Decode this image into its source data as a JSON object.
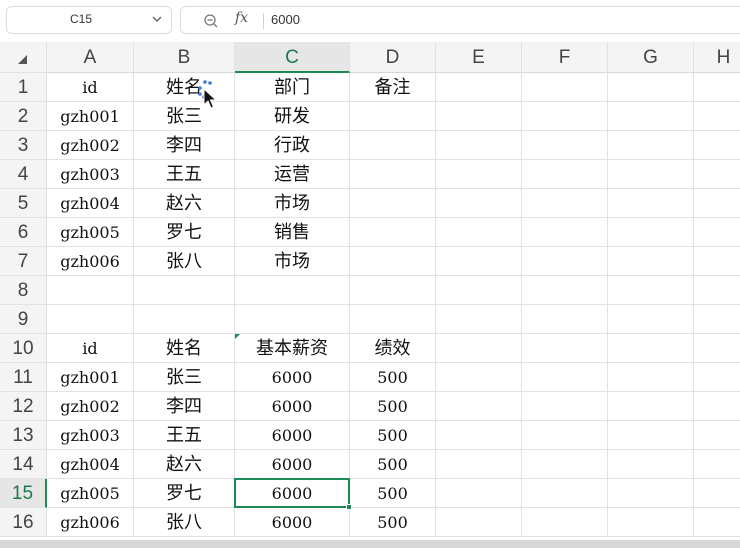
{
  "namebox": {
    "cell_ref": "C15"
  },
  "formula_bar": {
    "fx_label": "fx",
    "value": "6000"
  },
  "columns": [
    "A",
    "B",
    "C",
    "D",
    "E",
    "F",
    "G",
    "H"
  ],
  "active_column": "C",
  "active_row": "15",
  "rows": [
    {
      "num": "1",
      "cells": [
        "id",
        "姓名",
        "部门",
        "备注"
      ]
    },
    {
      "num": "2",
      "cells": [
        "gzh001",
        "张三",
        "研发",
        ""
      ]
    },
    {
      "num": "3",
      "cells": [
        "gzh002",
        "李四",
        "行政",
        ""
      ]
    },
    {
      "num": "4",
      "cells": [
        "gzh003",
        "王五",
        "运营",
        ""
      ]
    },
    {
      "num": "5",
      "cells": [
        "gzh004",
        "赵六",
        "市场",
        ""
      ]
    },
    {
      "num": "6",
      "cells": [
        "gzh005",
        "罗七",
        "销售",
        ""
      ]
    },
    {
      "num": "7",
      "cells": [
        "gzh006",
        "张八",
        "市场",
        ""
      ]
    },
    {
      "num": "8",
      "cells": [
        "",
        "",
        "",
        ""
      ]
    },
    {
      "num": "9",
      "cells": [
        "",
        "",
        "",
        ""
      ]
    },
    {
      "num": "10",
      "cells": [
        "id",
        "姓名",
        "基本薪资",
        "绩效"
      ]
    },
    {
      "num": "11",
      "cells": [
        "gzh001",
        "张三",
        "6000",
        "500"
      ]
    },
    {
      "num": "12",
      "cells": [
        "gzh002",
        "李四",
        "6000",
        "500"
      ]
    },
    {
      "num": "13",
      "cells": [
        "gzh003",
        "王五",
        "6000",
        "500"
      ]
    },
    {
      "num": "14",
      "cells": [
        "gzh004",
        "赵六",
        "6000",
        "500"
      ]
    },
    {
      "num": "15",
      "cells": [
        "gzh005",
        "罗七",
        "6000",
        "500"
      ]
    },
    {
      "num": "16",
      "cells": [
        "gzh006",
        "张八",
        "6000",
        "500"
      ]
    }
  ],
  "colors": {
    "accent": "#1b8a55",
    "header_bg": "#f4f4f4",
    "grid": "#e2e2e2"
  }
}
